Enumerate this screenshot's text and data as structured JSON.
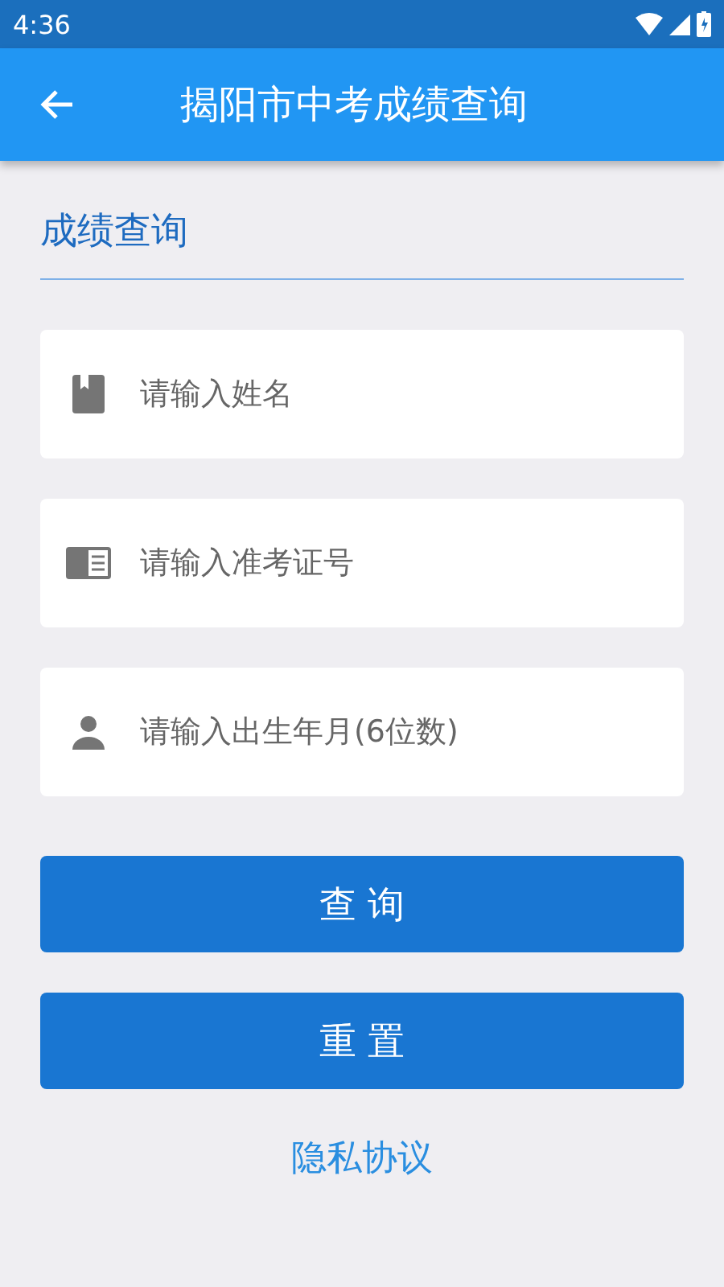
{
  "status_bar": {
    "time": "4:36"
  },
  "app_bar": {
    "title": "揭阳市中考成绩查询"
  },
  "section": {
    "title": "成绩查询"
  },
  "fields": [
    {
      "kind": "book",
      "placeholder": "请输入姓名"
    },
    {
      "kind": "card",
      "placeholder": "请输入准考证号"
    },
    {
      "kind": "person",
      "placeholder": "请输入出生年月(6位数)"
    }
  ],
  "buttons": [
    "查 询",
    "重 置"
  ],
  "link": "隐私协议"
}
